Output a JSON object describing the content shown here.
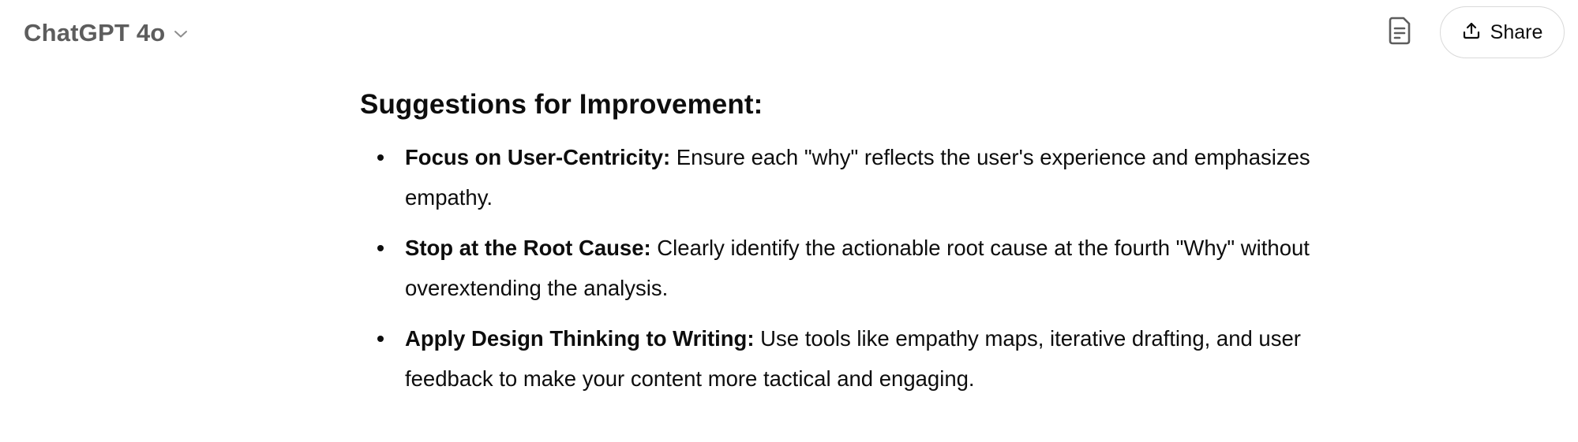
{
  "header": {
    "model_name": "ChatGPT 4o",
    "share_label": "Share",
    "icons": {
      "model_dropdown": "chevron-down-icon",
      "notes": "document-icon",
      "share": "share-upload-icon"
    }
  },
  "message": {
    "section_title": "Suggestions for Improvement:",
    "items": [
      {
        "title": "Focus on User-Centricity:",
        "text": " Ensure each \"why\" reflects the user's experience and emphasizes empathy."
      },
      {
        "title": "Stop at the Root Cause:",
        "text": " Clearly identify the actionable root cause at the fourth \"Why\" without overextending the analysis."
      },
      {
        "title": "Apply Design Thinking to Writing:",
        "text": " Use tools like empathy maps, iterative drafting, and user feedback to make your content more tactical and engaging."
      }
    ]
  },
  "colors": {
    "text": "#0d0d0d",
    "model_name": "#5d5d5d",
    "icon": "#5d5d5d",
    "share_border": "#d9d9d9",
    "background": "#ffffff"
  }
}
